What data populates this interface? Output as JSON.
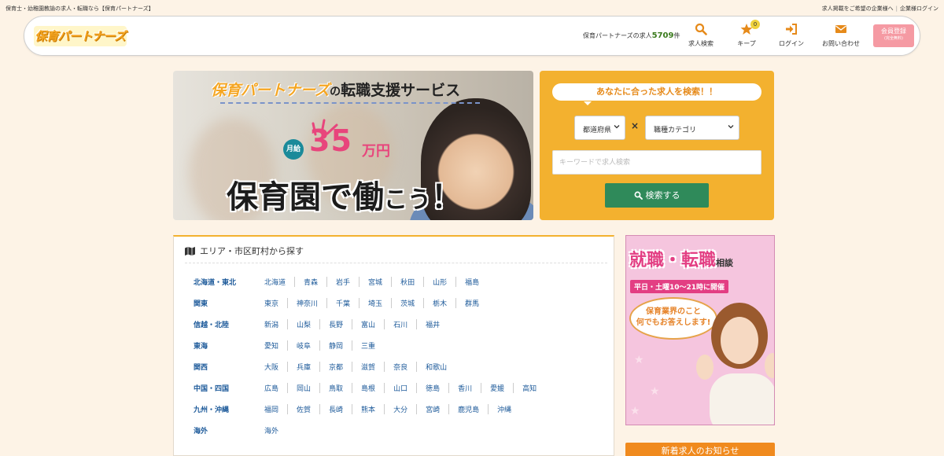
{
  "topbar": {
    "left_text": "保育士・幼稚園教諭の求人・転職なら【保育パートナーズ】",
    "recruit_link": "求人掲載をご希望の企業様へ",
    "company_login": "企業様ログイン"
  },
  "header": {
    "logo_text": "保育パートナーズ",
    "count_prefix": "保育パートナーズの求人",
    "count_value": "5709",
    "count_suffix": "件",
    "nav": [
      {
        "label": "求人検索",
        "icon": "search-icon"
      },
      {
        "label": "キープ",
        "icon": "star-icon",
        "badge": "0"
      },
      {
        "label": "ログイン",
        "icon": "login-icon"
      },
      {
        "label": "お問い合わせ",
        "icon": "mail-icon"
      }
    ],
    "register_label": "会員登録",
    "register_sub": "(完全無料)"
  },
  "hero": {
    "brand": "保育パートナーズ",
    "no": "の",
    "service": "転職支援サービス",
    "getsu": "月給",
    "amount": "35",
    "unit": "万円",
    "catch_main": "保育園で働",
    "catch_small": "こう",
    "catch_end": "！"
  },
  "search": {
    "heading": "あなたに合った求人を検索！！",
    "pref_select": "都道府県",
    "category_select": "職種カテゴリ",
    "times": "×",
    "keyword_placeholder": "キーワードで求人検索",
    "button_label": "検索する"
  },
  "area": {
    "heading": "エリア・市区町村から探す",
    "regions": [
      {
        "name": "北海道・東北",
        "prefs": [
          "北海道",
          "青森",
          "岩手",
          "宮城",
          "秋田",
          "山形",
          "福島"
        ]
      },
      {
        "name": "関東",
        "prefs": [
          "東京",
          "神奈川",
          "千葉",
          "埼玉",
          "茨城",
          "栃木",
          "群馬"
        ]
      },
      {
        "name": "信越・北陸",
        "prefs": [
          "新潟",
          "山梨",
          "長野",
          "富山",
          "石川",
          "福井"
        ]
      },
      {
        "name": "東海",
        "prefs": [
          "愛知",
          "岐阜",
          "静岡",
          "三重"
        ]
      },
      {
        "name": "関西",
        "prefs": [
          "大阪",
          "兵庫",
          "京都",
          "滋賀",
          "奈良",
          "和歌山"
        ]
      },
      {
        "name": "中国・四国",
        "prefs": [
          "広島",
          "岡山",
          "鳥取",
          "島根",
          "山口",
          "徳島",
          "香川",
          "愛媛",
          "高知"
        ]
      },
      {
        "name": "九州・沖縄",
        "prefs": [
          "福岡",
          "佐賀",
          "長崎",
          "熊本",
          "大分",
          "宮崎",
          "鹿児島",
          "沖縄"
        ]
      },
      {
        "name": "海外",
        "prefs": [
          "海外"
        ]
      }
    ]
  },
  "banner": {
    "title": "就職・転職",
    "title_suffix": "相談",
    "hours": "平日・土曜10～21時に開催",
    "qa_line1": "保育業界のこと",
    "qa_line2": "何でもお答えします!"
  },
  "newjobs": {
    "label": "新着求人のお知らせ"
  },
  "colors": {
    "accent_orange": "#f3b12f",
    "link_blue": "#1d5a9a",
    "button_green": "#2f8a5a",
    "pink": "#e33e83"
  }
}
